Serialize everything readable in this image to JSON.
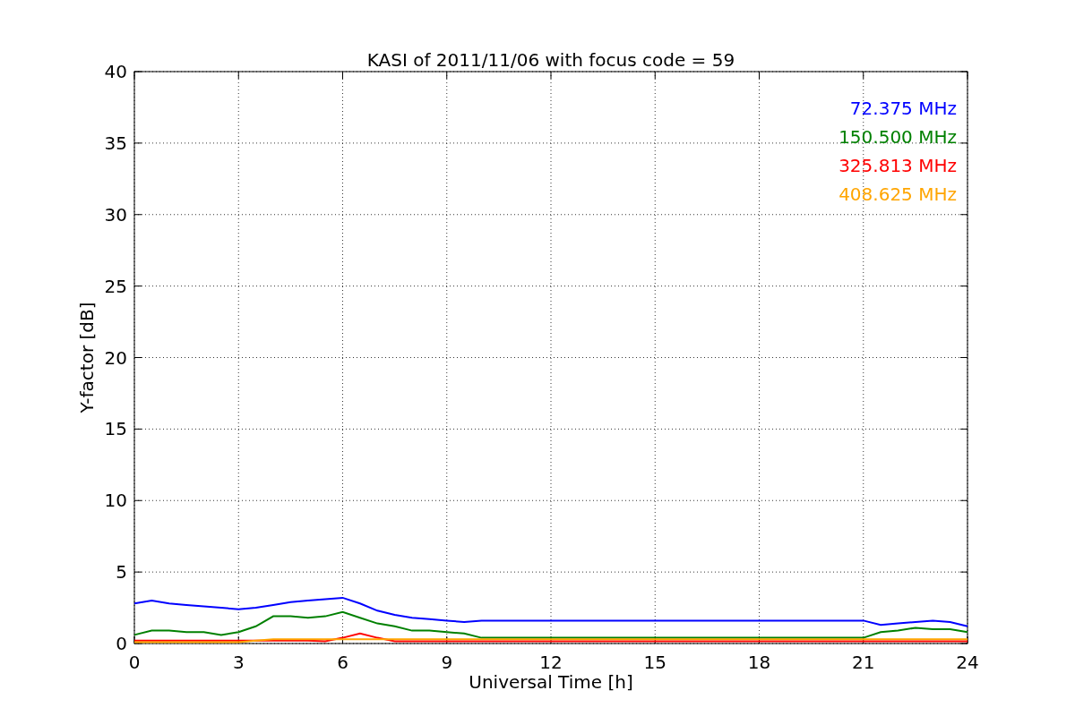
{
  "chart_data": {
    "type": "line",
    "title": "KASI of 2011/11/06 with focus code = 59",
    "xlabel": "Universal Time [h]",
    "ylabel": "Y-factor [dB]",
    "x": [
      0,
      0.5,
      1,
      1.5,
      2,
      2.5,
      3,
      3.5,
      4,
      4.5,
      5,
      5.5,
      6,
      6.5,
      7,
      7.5,
      8,
      8.5,
      9,
      9.5,
      10,
      21,
      21.5,
      22,
      22.5,
      23,
      23.5,
      24
    ],
    "series": [
      {
        "name": "72.375 MHz",
        "color": "#0000ff",
        "values": [
          2.8,
          3.0,
          2.8,
          2.7,
          2.6,
          2.5,
          2.4,
          2.5,
          2.7,
          2.9,
          3.0,
          3.1,
          3.2,
          2.8,
          2.3,
          2.0,
          1.8,
          1.7,
          1.6,
          1.5,
          1.6,
          1.6,
          1.3,
          1.4,
          1.5,
          1.6,
          1.5,
          1.2
        ]
      },
      {
        "name": "150.500 MHz",
        "color": "#008000",
        "values": [
          0.6,
          0.9,
          0.9,
          0.8,
          0.8,
          0.6,
          0.8,
          1.2,
          1.9,
          1.9,
          1.8,
          1.9,
          2.2,
          1.8,
          1.4,
          1.2,
          0.9,
          0.9,
          0.8,
          0.7,
          0.4,
          0.4,
          0.8,
          0.9,
          1.1,
          1.0,
          1.0,
          0.8
        ]
      },
      {
        "name": "325.813 MHz",
        "color": "#ff0000",
        "values": [
          0.2,
          0.2,
          0.2,
          0.2,
          0.2,
          0.2,
          0.2,
          0.2,
          0.2,
          0.2,
          0.2,
          0.15,
          0.4,
          0.7,
          0.4,
          0.15,
          0.15,
          0.15,
          0.15,
          0.15,
          0.15,
          0.15,
          0.15,
          0.15,
          0.15,
          0.15,
          0.15,
          0.15
        ]
      },
      {
        "name": "408.625 MHz",
        "color": "#ffa500",
        "values": [
          0.1,
          0.1,
          0.1,
          0.1,
          0.1,
          0.1,
          0.1,
          0.2,
          0.3,
          0.3,
          0.3,
          0.3,
          0.3,
          0.3,
          0.3,
          0.3,
          0.3,
          0.3,
          0.3,
          0.3,
          0.3,
          0.3,
          0.3,
          0.3,
          0.3,
          0.3,
          0.3,
          0.3
        ]
      }
    ],
    "xlim": [
      0,
      24
    ],
    "ylim": [
      0,
      40
    ],
    "xticks": [
      0,
      3,
      6,
      9,
      12,
      15,
      18,
      21,
      24
    ],
    "yticks": [
      0,
      5,
      10,
      15,
      20,
      25,
      30,
      35,
      40
    ],
    "grid": true
  }
}
